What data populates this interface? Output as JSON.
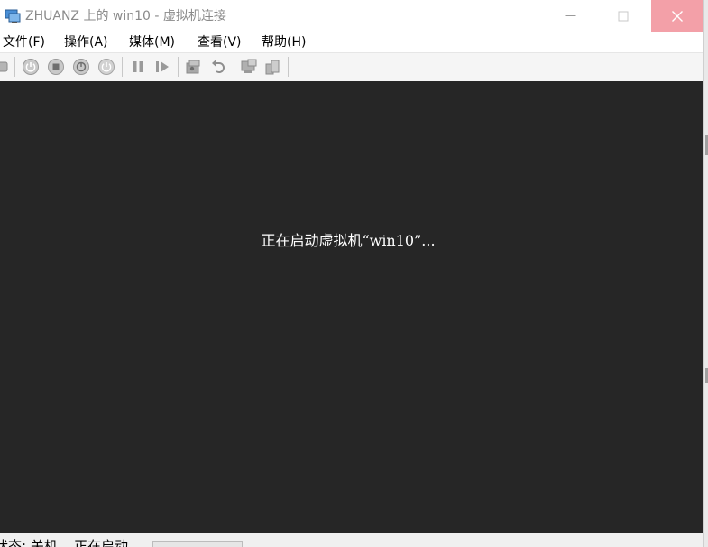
{
  "window": {
    "title": "ZHUANZ 上的 win10 - 虚拟机连接",
    "close_color": "#f3a0a8"
  },
  "menubar": {
    "items": [
      {
        "label": "文件(F)"
      },
      {
        "label": "操作(A)"
      },
      {
        "label": "媒体(M)"
      },
      {
        "label": "查看(V)"
      },
      {
        "label": "帮助(H)"
      }
    ]
  },
  "toolbar": {
    "buttons": [
      {
        "icon": "ctrl-alt-del-icon"
      },
      {
        "icon": "start-icon"
      },
      {
        "icon": "turn-off-icon"
      },
      {
        "icon": "shutdown-icon"
      },
      {
        "icon": "save-icon"
      },
      {
        "icon": "pause-icon"
      },
      {
        "icon": "resume-icon"
      },
      {
        "icon": "checkpoint-icon"
      },
      {
        "icon": "revert-icon"
      },
      {
        "icon": "enhanced-session-icon"
      },
      {
        "icon": "share-icon"
      }
    ]
  },
  "screen": {
    "message": "正在启动虚拟机“win10”...",
    "background": "#262626"
  },
  "statusbar": {
    "state": "状态: 关机",
    "activity": "正在启动..."
  }
}
